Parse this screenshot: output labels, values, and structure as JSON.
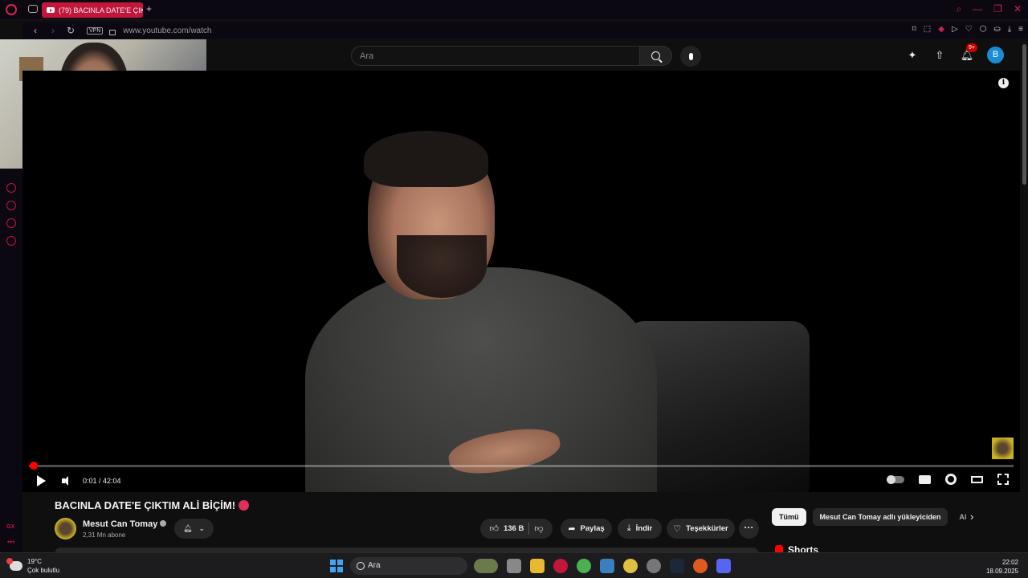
{
  "browser": {
    "tab_title": "(79) BACINLA DATE'E ÇIK",
    "new_tab": "+",
    "vpn_label": "VPN",
    "url": "www.youtube.com/watch",
    "sidebar_gx": "GX",
    "sidebar_more": "•••"
  },
  "youtube": {
    "search_placeholder": "Ara",
    "notifications_badge": "9+",
    "avatar_letter": "B",
    "info_icon": "i"
  },
  "player": {
    "time": "0:01 / 42:04",
    "progress_fraction": 0.0004
  },
  "video": {
    "title": "BACINLA DATE'E ÇIKTIM ALİ BİÇİM!",
    "channel_name": "Mesut Can Tomay",
    "subscribers": "2,31 Mn abone",
    "likes": "136 B",
    "share_label": "Paylaş",
    "download_label": "İndir",
    "thanks_label": "Teşekkürler",
    "more_label": "···"
  },
  "related": {
    "chips": [
      "Tümü",
      "Mesut Can Tomay adlı yükleyiciden",
      "Al"
    ],
    "shorts_label": "Shorts"
  },
  "taskbar": {
    "temperature": "19°C",
    "weather_desc": "Çok bulutlu",
    "weather_badge": "2",
    "search_label": "Ara",
    "time": "22:02",
    "date": "18.09.2025"
  },
  "colors": {
    "accent": "#c4153a",
    "youtube_red": "#ff0000",
    "background": "#0f0f0f"
  }
}
